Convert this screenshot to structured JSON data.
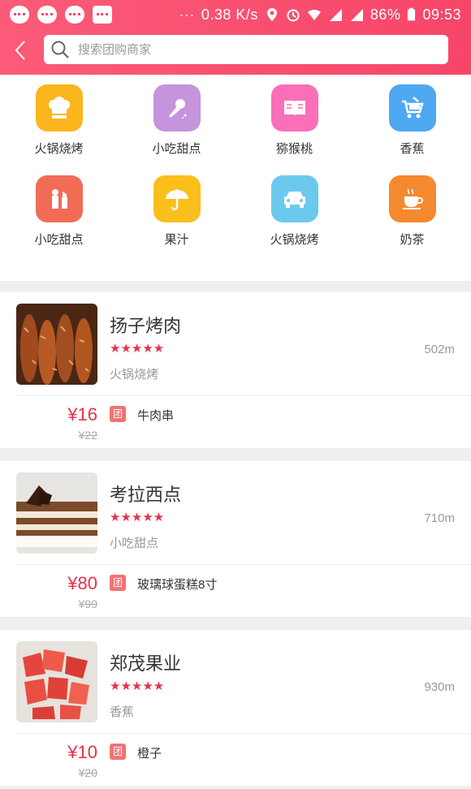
{
  "statusbar": {
    "speed": "0.38 K/s",
    "battery": "86%",
    "time": "09:53",
    "dots": "···"
  },
  "search": {
    "placeholder": "搜索团购商家"
  },
  "categories": [
    {
      "label": "火锅烧烤",
      "icon": "chef-hat-icon",
      "color": "#fbb51d"
    },
    {
      "label": "小吃甜点",
      "icon": "microphone-icon",
      "color": "#c594dc"
    },
    {
      "label": "猕猴桃",
      "icon": "book-icon",
      "color": "#fb6fb8"
    },
    {
      "label": "香蕉",
      "icon": "shopping-cart-icon",
      "color": "#4ea8f2"
    },
    {
      "label": "小吃甜点",
      "icon": "cosmetics-icon",
      "color": "#f26b55"
    },
    {
      "label": "果汁",
      "icon": "umbrella-icon",
      "color": "#fbbf1b"
    },
    {
      "label": "火锅烧烤",
      "icon": "car-icon",
      "color": "#6cc9ee"
    },
    {
      "label": "奶茶",
      "icon": "coffee-cup-icon",
      "color": "#f5892f"
    }
  ],
  "shops": [
    {
      "name": "扬子烤肉",
      "stars": "★★★★★",
      "distance": "502m",
      "category": "火锅烧烤",
      "price": "¥16",
      "old_price": "¥22",
      "tag": "团",
      "deal": "牛肉串"
    },
    {
      "name": "考拉西点",
      "stars": "★★★★★",
      "distance": "710m",
      "category": "小吃甜点",
      "price": "¥80",
      "old_price": "¥99",
      "tag": "团",
      "deal": "玻璃球蛋糕8寸"
    },
    {
      "name": "郑茂果业",
      "stars": "★★★★★",
      "distance": "930m",
      "category": "香蕉",
      "price": "¥10",
      "old_price": "¥20",
      "tag": "团",
      "deal": "橙子"
    }
  ],
  "colors": {
    "header": "#f7476b",
    "accent": "#e8314c"
  }
}
